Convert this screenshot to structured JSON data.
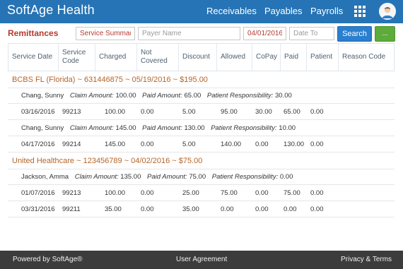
{
  "app": {
    "title": "SoftAge Health"
  },
  "nav": {
    "receivables": "Receivables",
    "payables": "Payables",
    "payrolls": "Payrolls",
    "apps_icon": "grid-icon",
    "profile_icon": "avatar-icon"
  },
  "filters": {
    "section_title": "Remittances",
    "summary_value": "Service Summary",
    "payer_placeholder": "Payer Name",
    "date_from_value": "04/01/2016",
    "date_to_placeholder": "Date To",
    "search_label": "Search",
    "more_label": "..."
  },
  "table": {
    "headers": {
      "service_date": "Service Date",
      "service_code": "Service Code",
      "charged": "Charged",
      "not_covered": "Not Covered",
      "discount": "Discount",
      "allowed": "Allowed",
      "copay": "CoPay",
      "paid": "Paid",
      "patient": "Patient",
      "reason_code": "Reason Code"
    },
    "labels": {
      "claim_amount": "Claim Amount:",
      "paid_amount": "Paid Amount:",
      "patient_responsibility": "Patient Responsibility:"
    },
    "groups": [
      {
        "title": "BCBS FL (Florida) ~ 631446875 ~ 05/19/2016 ~ $195.00",
        "claims": [
          {
            "patient": "Chang, Sunny",
            "claim_amount": "100.00",
            "paid_amount": "65.00",
            "patient_responsibility": "30.00",
            "lines": [
              {
                "service_date": "03/16/2016",
                "service_code": "99213",
                "charged": "100.00",
                "not_covered": "0.00",
                "discount": "5.00",
                "allowed": "95.00",
                "copay": "30.00",
                "paid": "65.00",
                "patient": "0.00",
                "reason_code": ""
              }
            ]
          },
          {
            "patient": "Chang, Sunny",
            "claim_amount": "145.00",
            "paid_amount": "130.00",
            "patient_responsibility": "10.00",
            "lines": [
              {
                "service_date": "04/17/2016",
                "service_code": "99214",
                "charged": "145.00",
                "not_covered": "0.00",
                "discount": "5.00",
                "allowed": "140.00",
                "copay": "0.00",
                "paid": "130.00",
                "patient": "0.00",
                "reason_code": ""
              }
            ]
          }
        ]
      },
      {
        "title": "United Healthcare ~ 123456789 ~ 04/02/2016 ~ $75.00",
        "claims": [
          {
            "patient": "Jackson, Amma",
            "claim_amount": "135.00",
            "paid_amount": "75.00",
            "patient_responsibility": "0.00",
            "lines": [
              {
                "service_date": "01/07/2016",
                "service_code": "99213",
                "charged": "100.00",
                "not_covered": "0.00",
                "discount": "25.00",
                "allowed": "75.00",
                "copay": "0.00",
                "paid": "75.00",
                "patient": "0.00",
                "reason_code": ""
              },
              {
                "service_date": "03/31/2016",
                "service_code": "99211",
                "charged": "35.00",
                "not_covered": "0.00",
                "discount": "35.00",
                "allowed": "0.00",
                "copay": "0.00",
                "paid": "0.00",
                "patient": "0.00",
                "reason_code": ""
              }
            ]
          }
        ]
      }
    ]
  },
  "footer": {
    "powered_by": "Powered by SoftAge®",
    "user_agreement": "User Agreement",
    "privacy": "Privacy & Terms"
  },
  "colors": {
    "header_bg": "#2674b5",
    "section_title": "#b53a2e",
    "group_title": "#b5652a",
    "search_button": "#2a7fcf",
    "more_button": "#5cab3b",
    "footer_bg": "#3c3c3c"
  }
}
